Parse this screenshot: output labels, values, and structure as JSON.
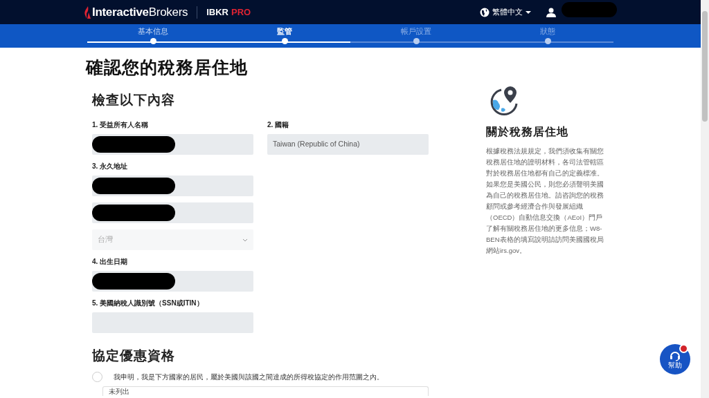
{
  "header": {
    "logo_text": "**Interactive**Brokers",
    "product": "IBKR",
    "edition": "PRO",
    "language": "繁體中文",
    "user_redacted": true
  },
  "steps": [
    {
      "label": "基本信息",
      "done": true,
      "selected": false
    },
    {
      "label": "監管",
      "done": true,
      "selected": true
    },
    {
      "label": "帳戶設置",
      "done": false,
      "selected": false
    },
    {
      "label": "狀態",
      "done": false,
      "selected": false
    }
  ],
  "page_title": "確認您的稅務居住地",
  "review": {
    "heading": "檢查以下內容",
    "rows": [
      [
        {
          "label": "1. 受益所有人名稱",
          "kind": "redacted"
        },
        {
          "label": "2. 國籍",
          "kind": "input",
          "value": "Taiwan (Republic of China)"
        }
      ],
      [
        {
          "label": "3. 永久地址",
          "kind": "redacted"
        }
      ],
      [
        {
          "kind": "redacted"
        }
      ],
      [
        {
          "kind": "select",
          "value": "台灣"
        }
      ],
      [
        {
          "label": "4. 出生日期",
          "kind": "redacted"
        }
      ],
      [
        {
          "label": "5. 美國納稅人識別號（SSN或ITIN）",
          "kind": "input"
        }
      ]
    ]
  },
  "treaty": {
    "heading": "協定優惠資格",
    "claim": {
      "text": "我申明，我是下方國家的居民，屬於美國與該國之間達成的所得稅協定的作用范圍之內。",
      "checked": false
    },
    "country": "未列出"
  },
  "sidebar": {
    "title": "關於稅務居住地",
    "body": "根據稅務法規規定，我們須收集有關您稅務居住地的證明材料，各司法管轄區對於稅務居住地都有自己的定義標准。如果您是美國公民，則您必須聲明美國為自己的稅務居住地。請咨詢您的稅務顧問或參考經濟合作與發展組織（OECD）自動信息交換（AEoI）門戶了解有關稅務居住地的更多信息；W8-BEN表格的填寫說明請訪問美國國稅局網站irs.gov。"
  },
  "help": {
    "label": "幫助",
    "notification": true
  }
}
